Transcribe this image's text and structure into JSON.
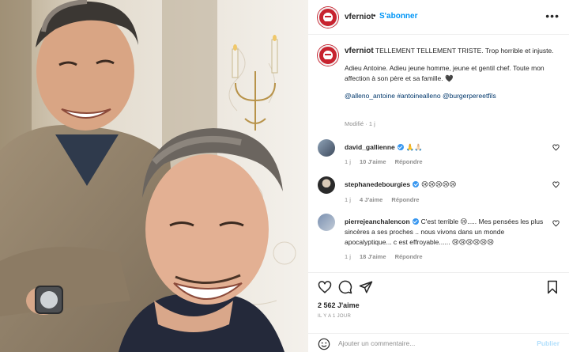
{
  "post": {
    "username": "vferniot",
    "follow_label": "S'abonner",
    "more_icon": "more-dots-icon"
  },
  "caption": {
    "username": "vferniot",
    "line1": "TELLEMENT TELLEMENT TRISTE. Trop horrible et injuste.",
    "line2": "Adieu Antoine. Adieu jeune homme, jeune et gentil chef. Toute mon affection à son père et sa famille. 🖤",
    "tags": [
      "@alleno_antoine",
      "#antoinealleno",
      "@burgerpereetfils"
    ],
    "modified": "Modifié · 1 j"
  },
  "comments": [
    {
      "username": "david_gallienne",
      "verified": true,
      "text": "🙏🙏🏻",
      "age": "1 j",
      "likes": "10 J'aime",
      "reply": "Répondre"
    },
    {
      "username": "stephanedebourgies",
      "verified": true,
      "text": "😢😢😢😢😢",
      "age": "1 j",
      "likes": "4 J'aime",
      "reply": "Répondre"
    },
    {
      "username": "pierrejeanchalencon",
      "verified": true,
      "text": "C'est terrible 😢..... Mes pensées les plus sincères a ses proches .. nous vivons dans un monde apocalyptique... c est effroyable...... 😢😢😢😢😢😢",
      "age": "1 j",
      "likes": "18 J'aime",
      "reply": "Répondre"
    }
  ],
  "actions": {
    "like_icon": "heart-icon",
    "comment_icon": "comment-icon",
    "share_icon": "share-icon",
    "save_icon": "bookmark-icon",
    "likes": "2 562 J'aime",
    "date": "IL Y A 1 JOUR"
  },
  "add_comment": {
    "placeholder": "Ajouter un commentaire...",
    "publish": "Publier"
  },
  "colors": {
    "accent": "#0095f6",
    "brand": "#c7232f",
    "muted": "#8e8e8e"
  }
}
